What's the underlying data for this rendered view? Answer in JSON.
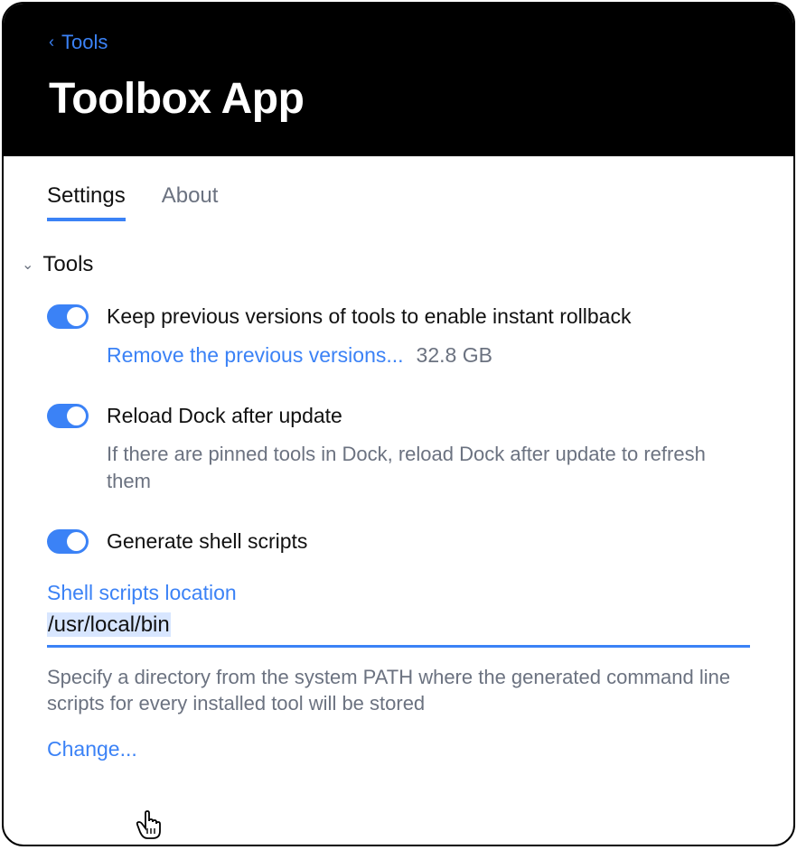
{
  "header": {
    "back_label": "Tools",
    "title": "Toolbox App"
  },
  "tabs": {
    "settings": "Settings",
    "about": "About",
    "active": "settings"
  },
  "section": {
    "title": "Tools"
  },
  "toggles": {
    "keep_versions": {
      "on": true,
      "label": "Keep previous versions of tools to enable instant rollback",
      "remove_link": "Remove the previous versions...",
      "size": "32.8 GB"
    },
    "reload_dock": {
      "on": true,
      "label": "Reload Dock after update",
      "help": "If there are pinned tools in Dock, reload Dock after update to refresh them"
    },
    "shell_scripts": {
      "on": true,
      "label": "Generate shell scripts"
    }
  },
  "shell_location": {
    "label": "Shell scripts location",
    "value": "/usr/local/bin",
    "help": "Specify a directory from the system PATH where the generated command line scripts for every installed tool will be stored",
    "change_label": "Change..."
  }
}
